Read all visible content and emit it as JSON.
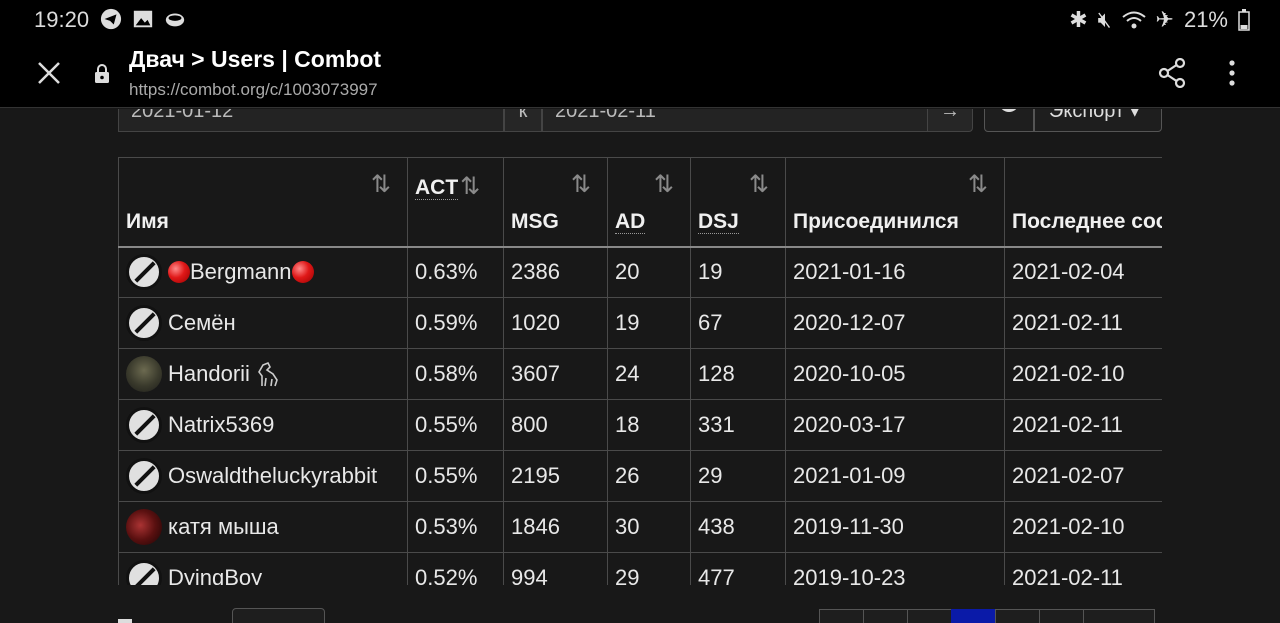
{
  "status_bar": {
    "time": "19:20",
    "battery": "21%",
    "icons_left": [
      "telegram-icon",
      "image-icon",
      "cloud-icon"
    ],
    "icons_right": [
      "bluetooth-icon",
      "mute-icon",
      "wifi-icon",
      "airplane-icon",
      "battery-icon"
    ]
  },
  "browser": {
    "title": "Двач > Users | Combot",
    "url": "https://combot.org/c/1003073997"
  },
  "filters": {
    "date_from": "2021-01-12",
    "separator": "к",
    "date_to": "2021-02-11",
    "go_label": "→",
    "export_label": "Экспорт ▾"
  },
  "table": {
    "headers": [
      {
        "label": "Имя",
        "abbr": false
      },
      {
        "label": "ACT",
        "abbr": true
      },
      {
        "label": "MSG",
        "abbr": false
      },
      {
        "label": "AD",
        "abbr": true
      },
      {
        "label": "DSJ",
        "abbr": true
      },
      {
        "label": "Присоединился",
        "abbr": false
      },
      {
        "label": "Последнее сообщение",
        "abbr": false
      }
    ],
    "sort_glyph": "⇅",
    "rows": [
      {
        "name": "Bergmann",
        "avatar": "banned-icon",
        "act": "0.63%",
        "msg": "2386",
        "ad": "20",
        "dsj": "19",
        "joined": "2021-01-16",
        "last": "2021-02-04"
      },
      {
        "name": "Семён",
        "avatar": "banned-icon",
        "act": "0.59%",
        "msg": "1020",
        "ad": "19",
        "dsj": "67",
        "joined": "2020-12-07",
        "last": "2021-02-11"
      },
      {
        "name": "Handorii",
        "avatar": "photo",
        "act": "0.58%",
        "msg": "3607",
        "ad": "24",
        "dsj": "128",
        "joined": "2020-10-05",
        "last": "2021-02-10"
      },
      {
        "name": "Natrix5369",
        "avatar": "banned-icon",
        "act": "0.55%",
        "msg": "800",
        "ad": "18",
        "dsj": "331",
        "joined": "2020-03-17",
        "last": "2021-02-11"
      },
      {
        "name": "Oswaldtheluckyrabbit",
        "avatar": "banned-icon",
        "act": "0.55%",
        "msg": "2195",
        "ad": "26",
        "dsj": "29",
        "joined": "2021-01-09",
        "last": "2021-02-07"
      },
      {
        "name": "катя мыша",
        "avatar": "photo",
        "act": "0.53%",
        "msg": "1846",
        "ad": "30",
        "dsj": "438",
        "joined": "2019-11-30",
        "last": "2021-02-10"
      },
      {
        "name": "DyingBoy",
        "avatar": "banned-icon",
        "act": "0.52%",
        "msg": "994",
        "ad": "29",
        "dsj": "477",
        "joined": "2019-10-23",
        "last": "2021-02-11"
      }
    ]
  },
  "colors": {
    "background": "#181818",
    "toolbar": "#000000",
    "pager_active": "#0a1aa8"
  }
}
